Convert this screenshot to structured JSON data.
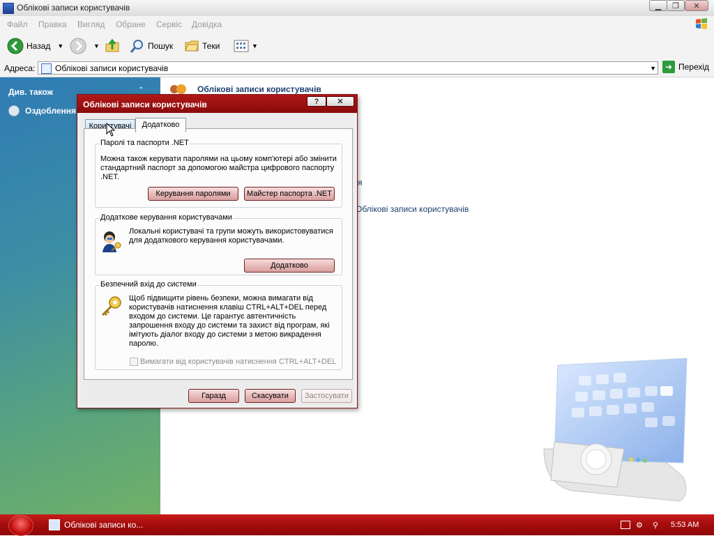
{
  "window": {
    "title": "Облікові записи користувачів",
    "controls": [
      "minimize",
      "maximize",
      "close"
    ]
  },
  "menu": [
    "Файл",
    "Правка",
    "Вигляд",
    "Обране",
    "Сервіс",
    "Довідка"
  ],
  "toolbar": {
    "back_label": "Назад",
    "search_label": "Пошук",
    "folders_label": "Теки"
  },
  "address": {
    "label": "Адреса:",
    "value": "Облікові записи користувачів",
    "go_label": "Перехід"
  },
  "sidebar": {
    "title": "Див. також",
    "items": [
      {
        "label": "Оздоблення т"
      }
    ]
  },
  "main": {
    "heading": "Облікові записи користувачів",
    "partial_link": "я",
    "partial_link2": "Облікові записи користувачів"
  },
  "dialog": {
    "title": "Облікові записи користувачів",
    "help_label": "?",
    "close_label": "✕",
    "tabs": [
      {
        "label": "Користувачі",
        "active": false
      },
      {
        "label": "Додатково",
        "active": true
      }
    ],
    "groups": {
      "passwords": {
        "title": "Паролі та паспорти .NET",
        "text": "Можна також керувати паролями на цьому комп'ютері або змінити стандартний паспорт за допомогою майстра цифрового паспорту .NET.",
        "btn_manage": "Керування паролями",
        "btn_wizard": "Майстер паспорта .NET"
      },
      "advanced": {
        "title": "Додаткове керування користувачами",
        "text": "Локальні користувачі та групи можуть використовуватися для додаткового керування користувачами.",
        "btn": "Додатково"
      },
      "secure": {
        "title": "Безпечний вхід до системи",
        "text": "Щоб підвищити рівень безпеки, можна вимагати від користувачів натиснення клавіш CTRL+ALT+DEL перед входом до системи. Це гарантує автентичність запрошення входу до системи та захист від програм, які імітують діалог входу до системи з метою викрадення паролю.",
        "checkbox": "Вимагати від користувачів натиснення CTRL+ALT+DEL",
        "checked": false
      }
    },
    "buttons": {
      "ok": "Гаразд",
      "cancel": "Скасувати",
      "apply": "Застосувати"
    }
  },
  "taskbar": {
    "task_label": "Облікові записи ко...",
    "clock": "5:53 AM"
  },
  "colors": {
    "accent": "#b01818",
    "sidebar_top": "#2f7bb4",
    "sidebar_bottom": "#70b068",
    "link": "#1d3f6e"
  }
}
